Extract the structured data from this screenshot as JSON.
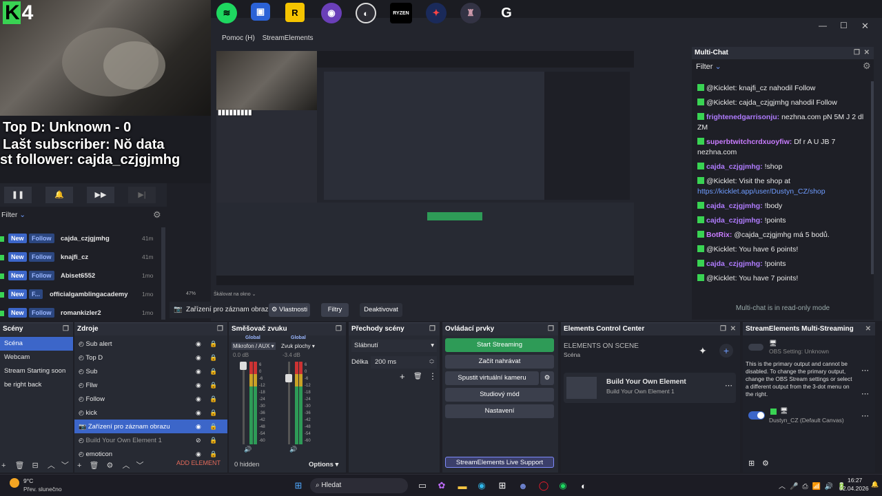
{
  "overlay": {
    "brand": "K4",
    "top_d": "Top D: Unknown - 0",
    "last_sub": "Lašt subscriber: Nŏ data",
    "last_follower": "st follower: cajda_czjgjmhg"
  },
  "menu": {
    "help": "Pomoc (H)",
    "streamelements": "StreamElements"
  },
  "topbar_icons": [
    "spotify-icon",
    "gamepad-icon",
    "rockstar-icon",
    "app-icon",
    "obs-icon",
    "ryzen-icon",
    "app2-icon",
    "app3-icon",
    "g-icon"
  ],
  "ryzen_label": "RYZEN",
  "rockstar_label": "R",
  "g_label": "G",
  "multichat": {
    "title": "Multi-Chat",
    "filter": "Filter",
    "readonly": "Multi-chat is in read-only mode",
    "messages": [
      {
        "user": "@Kicklet:",
        "text": "knajfi_cz nahodil Follow",
        "style": "plain"
      },
      {
        "user": "@Kicklet:",
        "text": "cajda_czjgjmhg nahodil Follow",
        "style": "plain"
      },
      {
        "user": "frightenedgarrisonju:",
        "text": "nezhna.com pN 5M J 2 dl ZM",
        "style": "u1"
      },
      {
        "user": "superbtwitchcrdxuoyfiw:",
        "text": "Df r A U JB 7 nezhna.com",
        "style": "u2"
      },
      {
        "user": "cajda_czjgjmhg:",
        "text": "!shop",
        "style": "u1"
      },
      {
        "user": "@Kicklet:",
        "text": "Visit the shop at",
        "style": "plain"
      },
      {
        "user": "cajda_czjgjmhg:",
        "text": "!body",
        "style": "u1"
      },
      {
        "user": "cajda_czjgjmhg:",
        "text": "!points",
        "style": "u1"
      },
      {
        "user": "BotRix:",
        "text": "@cajda_czjgjmhg má 5 bodů.",
        "style": "u2"
      },
      {
        "user": "@Kicklet:",
        "text": "You have 6 points!",
        "style": "plain"
      },
      {
        "user": "cajda_czjgjmhg:",
        "text": "!points",
        "style": "u1"
      },
      {
        "user": "@Kicklet:",
        "text": "You have 7 points!",
        "style": "plain"
      }
    ],
    "shop_link": "https://kicklet.app/user/Dustyn_CZ/shop"
  },
  "follows": {
    "filter": "Filter",
    "items": [
      {
        "name": "cajda_czjgjmhg",
        "time": "41m",
        "type": "Follow"
      },
      {
        "name": "knajfi_cz",
        "time": "41m",
        "type": "Follow"
      },
      {
        "name": "Abiset6552",
        "time": "1mo",
        "type": "Follow"
      },
      {
        "name": "officialgamblingacademy",
        "time": "1mo",
        "type": "F..."
      },
      {
        "name": "romankizler2",
        "time": "1mo",
        "type": "Follow"
      }
    ],
    "new_tag": "New"
  },
  "source_toolbar": {
    "selected": "Zařízení pro záznam obrazu",
    "props": "Vlastnosti",
    "filters": "Filtry",
    "deactivate": "Deaktivovat"
  },
  "preview": {
    "zoom": "47%",
    "scale_mode": "Škálovat na okno"
  },
  "scenes": {
    "title": "Scény",
    "items": [
      "Scéna",
      "Webcam",
      "Stream Starting soon",
      "be right back"
    ]
  },
  "sources": {
    "title": "Zdroje",
    "items": [
      "Sub alert",
      "Top D",
      "Sub",
      "Fllw",
      "Follow",
      "kick",
      "Zařízení pro záznam obrazu",
      "Build Your Own Element 1",
      "emoticon"
    ],
    "add_element": "ADD ELEMENT"
  },
  "mixer": {
    "title": "Směšovač zvuku",
    "ch1": {
      "scope": "Global",
      "name": "Mikrofon / AUX",
      "db": "0.0 dB"
    },
    "ch2": {
      "scope": "Global",
      "name": "Zvuk plochy",
      "db": "-3.4 dB"
    },
    "scale": [
      "6",
      "0",
      "-6",
      "-12",
      "-18",
      "-24",
      "-30",
      "-36",
      "-42",
      "-48",
      "-54",
      "-60"
    ],
    "hidden": "0 hidden",
    "options": "Options"
  },
  "transitions": {
    "title": "Přechody scény",
    "type": "Slábnutí",
    "duration_label": "Délka",
    "duration": "200 ms"
  },
  "controls": {
    "title": "Ovládací prvky",
    "start_stream": "Start Streaming",
    "record": "Začít nahrávat",
    "vcam": "Spustit virtuální kameru",
    "studio": "Studiový mód",
    "settings": "Nastavení",
    "support": "StreamElements Live Support"
  },
  "ecc": {
    "title": "Elements Control Center",
    "heading": "ELEMENTS ON SCENE",
    "scene": "Scéna",
    "card_title": "Build Your Own Element",
    "card_sub": "Build Your Own Element 1"
  },
  "multistream": {
    "title": "StreamElements Multi-Streaming",
    "obs_setting": "OBS Setting: Unknown",
    "note": "This is the primary output and cannot be disabled. To change the primary output, change the OBS Stream settings or select a different output from the 3-dot menu on the right.",
    "canvas": "Dustyn_CZ (Default Canvas)"
  },
  "taskbar": {
    "temp": "9°C",
    "weather": "Přev. slunečno",
    "search": "Hledat",
    "time": "16:27",
    "date": "02.04.2026"
  },
  "colors": {
    "accent": "#3c66c9",
    "green": "#2e9b57",
    "kick": "#39d353",
    "bg": "#1e1f26",
    "panel": "#272a33"
  }
}
